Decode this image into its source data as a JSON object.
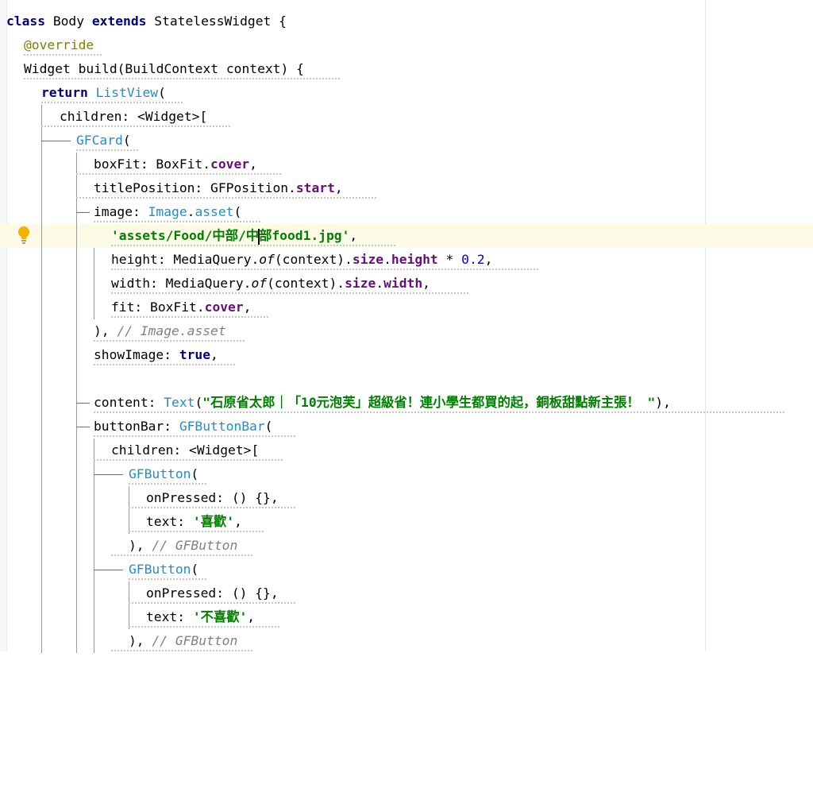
{
  "code": {
    "l1_kw1": "class",
    "l1_text1": " Body ",
    "l1_kw2": "extends",
    "l1_text2": " StatelessWidget {",
    "l2_ann": "@override",
    "l3_text": "Widget build(BuildContext context) {",
    "l4_kw": "return",
    "l4_cls": "ListView",
    "l4_paren": "(",
    "l5_text": "children: <Widget>[",
    "l6_cls": "GFCard",
    "l6_paren": "(",
    "l7_text1": "boxFit: BoxFit.",
    "l7_fld": "cover",
    "l7_text2": ",",
    "l8_text1": "titlePosition: GFPosition.",
    "l8_fld": "start",
    "l8_text2": ",",
    "l9_text1": "image: ",
    "l9_cls1": "Image",
    "l9_dot": ".",
    "l9_cls2": "asset",
    "l9_paren": "(",
    "l10_str1": "'assets/Food/中部/中",
    "l10_str2": "部food1.jpg'",
    "l10_comma": ",",
    "l11_text1": "height: MediaQuery.",
    "l11_it": "of",
    "l11_text2": "(context).",
    "l11_fld1": "size",
    "l11_dot": ".",
    "l11_fld2": "height",
    "l11_text3": " * ",
    "l11_num": "0.2",
    "l11_text4": ",",
    "l12_text1": "width: MediaQuery.",
    "l12_it": "of",
    "l12_text2": "(context).",
    "l12_fld1": "size",
    "l12_dot": ".",
    "l12_fld2": "width",
    "l12_text3": ",",
    "l13_text1": "fit: BoxFit.",
    "l13_fld": "cover",
    "l13_text2": ",",
    "l14_text": "), ",
    "l14_cmt": "// Image.asset",
    "l15_text1": "showImage: ",
    "l15_kw": "true",
    "l15_text2": ",",
    "l17_text1": "content: ",
    "l17_cls": "Text",
    "l17_paren": "(",
    "l17_str": "\"石原省太郎｜「10元泡芙」超級省！連小學生都買的起，銅板甜點新主張！ \"",
    "l17_end": "),",
    "l18_text1": "buttonBar: ",
    "l18_cls": "GFButtonBar",
    "l18_paren": "(",
    "l19_text": "children: <Widget>[",
    "l20_cls": "GFButton",
    "l20_paren": "(",
    "l21_text": "onPressed: () {},",
    "l22_text1": "text: ",
    "l22_str": "'喜歡'",
    "l22_text2": ",",
    "l23_text": "), ",
    "l23_cmt": "// GFButton",
    "l24_cls": "GFButton",
    "l24_paren": "(",
    "l25_text": "onPressed: () {},",
    "l26_text1": "text: ",
    "l26_str": "'不喜歡'",
    "l26_text2": ",",
    "l27_text": "), ",
    "l27_cmt": "// GFButton"
  },
  "icons": {
    "intention": "lightbulb-icon"
  },
  "colors": {
    "keyword": "#000080",
    "annotation": "#808000",
    "string": "#008000",
    "class_ref": "#1f8ecf",
    "number": "#0000ff",
    "comment": "#808080",
    "field": "#660e7a",
    "current_line": "#fdfbe6"
  }
}
